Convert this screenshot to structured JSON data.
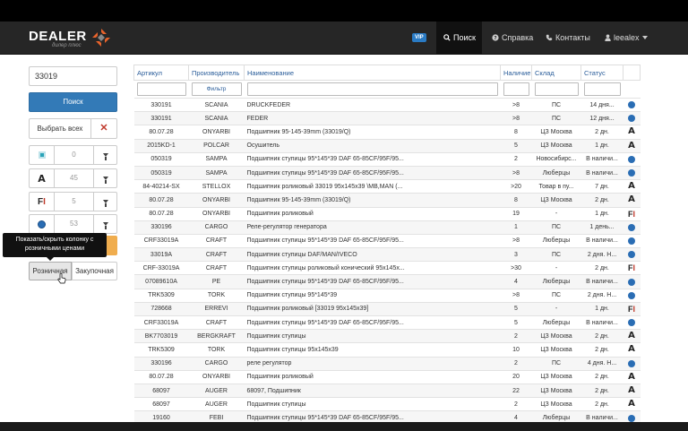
{
  "navbar": {
    "logo": "DEALER",
    "logo_sub": "дилер плюс",
    "vip": "VIP",
    "search": "Поиск",
    "help": "Справка",
    "contacts": "Контакты",
    "user": "leealex"
  },
  "sidebar": {
    "search_value": "33019",
    "search_button": "Поиск",
    "select_all": "Выбрать всех",
    "clear": "✕",
    "sources": [
      {
        "icon": "square-icon",
        "count": "0"
      },
      {
        "icon": "letter-a-icon",
        "count": "45"
      },
      {
        "icon": "letter-f-icon",
        "count": "5"
      },
      {
        "icon": "blue-ball-icon",
        "count": "53"
      }
    ],
    "tooltip": "Показать/скрыть колонку с розничными ценами",
    "tab_retail": "Розничная",
    "tab_purchase": "Закупочная"
  },
  "table": {
    "headers": [
      "Артикул",
      "Производитель",
      "Наименование",
      "Наличие",
      "Склад",
      "Статус"
    ],
    "filter_placeholder": "Фильтр",
    "rows": [
      {
        "article": "330191",
        "maker": "SCANIA",
        "name": "DRUCKFEDER",
        "stock": ">8",
        "wh": "ПС",
        "status": "14 дня...",
        "icon": "ball"
      },
      {
        "article": "330191",
        "maker": "SCANIA",
        "name": "FEDER",
        "stock": ">8",
        "wh": "ПС",
        "status": "12 дня...",
        "icon": "ball"
      },
      {
        "article": "80.07.28",
        "maker": "ONYARBI",
        "name": "Подшипник 95-145-39mm (33019/Q)",
        "stock": "8",
        "wh": "ЦЗ Москва",
        "status": "2 дн.",
        "icon": "A"
      },
      {
        "article": "2015KD-1",
        "maker": "POLCAR",
        "name": "Осушитель",
        "stock": "5",
        "wh": "ЦЗ Москва",
        "status": "1 дн.",
        "icon": "A"
      },
      {
        "article": "050319",
        "maker": "SAMPA",
        "name": "Подшипник ступицы 95*145*39 DAF 65-85CF/95F/95...",
        "stock": "2",
        "wh": "Новосибирс...",
        "status": "В наличи...",
        "icon": "ball"
      },
      {
        "article": "050319",
        "maker": "SAMPA",
        "name": "Подшипник ступицы 95*145*39 DAF 65-85CF/95F/95...",
        "stock": ">8",
        "wh": "Люберцы",
        "status": "В наличи...",
        "icon": "ball"
      },
      {
        "article": "84-40214-SX",
        "maker": "STELLOX",
        "name": "Подшипник роликовый 33019 95x145x39 \\MB,MAN (...",
        "stock": ">20",
        "wh": "Товар в пу...",
        "status": "7 дн.",
        "icon": "A"
      },
      {
        "article": "80.07.28",
        "maker": "ONYARBI",
        "name": "Подшипник 95-145-39mm (33019/Q)",
        "stock": "8",
        "wh": "ЦЗ Москва",
        "status": "2 дн.",
        "icon": "A"
      },
      {
        "article": "80.07.28",
        "maker": "ONYARBI",
        "name": "Подшипник роликовый",
        "stock": "19",
        "wh": "-",
        "status": "1 дн.",
        "icon": "F"
      },
      {
        "article": "330196",
        "maker": "CARGO",
        "name": "Реле-регулятор генератора",
        "stock": "1",
        "wh": "ПС",
        "status": "1 день...",
        "icon": "ball"
      },
      {
        "article": "CRF33019A",
        "maker": "CRAFT",
        "name": "Подшипник ступицы 95*145*39 DAF 65-85CF/95F/95...",
        "stock": ">8",
        "wh": "Люберцы",
        "status": "В наличи...",
        "icon": "ball"
      },
      {
        "article": "33019A",
        "maker": "CRAFT",
        "name": "Подшипник ступицы DAF/MAN/IVECO",
        "stock": "3",
        "wh": "ПС",
        "status": "2 дня. Н...",
        "icon": "ball"
      },
      {
        "article": "CRF-33019A",
        "maker": "CRAFT",
        "name": "Подшипник ступицы роликовый конический 95x145x...",
        "stock": ">30",
        "wh": "-",
        "status": "2 дн.",
        "icon": "F"
      },
      {
        "article": "07089610A",
        "maker": "PE",
        "name": "Подшипник ступицы 95*145*39 DAF 65-85CF/95F/95...",
        "stock": "4",
        "wh": "Люберцы",
        "status": "В наличи...",
        "icon": "ball"
      },
      {
        "article": "TRK5309",
        "maker": "TORK",
        "name": "Подшипник ступицы 95*145*39",
        "stock": ">8",
        "wh": "ПС",
        "status": "2 дня. Н...",
        "icon": "ball"
      },
      {
        "article": "728668",
        "maker": "ERREVI",
        "name": "Подшипник роликовый [33019 95x145x39]",
        "stock": "5",
        "wh": "-",
        "status": "1 дн.",
        "icon": "F"
      },
      {
        "article": "CRF33019A",
        "maker": "CRAFT",
        "name": "Подшипник ступицы 95*145*39 DAF 65-85CF/95F/95...",
        "stock": "5",
        "wh": "Люберцы",
        "status": "В наличи...",
        "icon": "ball"
      },
      {
        "article": "BK7703019",
        "maker": "BERGKRAFT",
        "name": "Подшипник ступицы",
        "stock": "2",
        "wh": "ЦЗ Москва",
        "status": "2 дн.",
        "icon": "A"
      },
      {
        "article": "TRK5309",
        "maker": "TORK",
        "name": "Подшипник ступицы 95x145x39",
        "stock": "10",
        "wh": "ЦЗ Москва",
        "status": "2 дн.",
        "icon": "A"
      },
      {
        "article": "330196",
        "maker": "CARGO",
        "name": "реле регулятор",
        "stock": "2",
        "wh": "ПС",
        "status": "4 дня. Н...",
        "icon": "ball"
      },
      {
        "article": "80.07.28",
        "maker": "ONYARBI",
        "name": "Подшипник роликовый",
        "stock": "20",
        "wh": "ЦЗ Москва",
        "status": "2 дн.",
        "icon": "A"
      },
      {
        "article": "68097",
        "maker": "AUGER",
        "name": "68097, Подшипник",
        "stock": "22",
        "wh": "ЦЗ Москва",
        "status": "2 дн.",
        "icon": "A"
      },
      {
        "article": "68097",
        "maker": "AUGER",
        "name": "Подшипник ступицы",
        "stock": "2",
        "wh": "ЦЗ Москва",
        "status": "2 дн.",
        "icon": "A"
      },
      {
        "article": "19160",
        "maker": "FEBI",
        "name": "Подшипник ступицы 95*145*39 DAF 65-85CF/95F/95...",
        "stock": "4",
        "wh": "Люберцы",
        "status": "В наличи...",
        "icon": "ball"
      }
    ]
  },
  "colors": {
    "navbar": "#262626",
    "primary": "#337ab7",
    "header_text": "#2a5d9a",
    "accent_orange": "#f0ad4e",
    "danger": "#c0392b"
  }
}
